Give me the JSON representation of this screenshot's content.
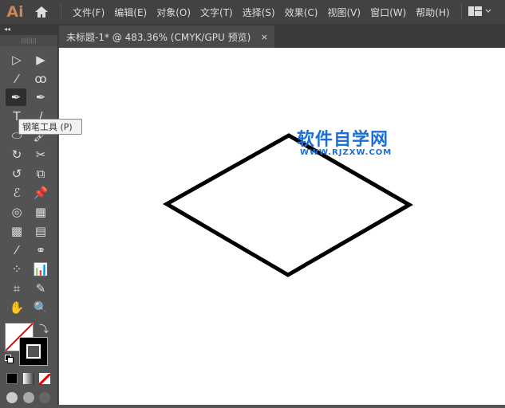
{
  "app": {
    "logo": "Ai"
  },
  "menu": [
    "文件(F)",
    "编辑(E)",
    "对象(O)",
    "文字(T)",
    "选择(S)",
    "效果(C)",
    "视图(V)",
    "窗口(W)",
    "帮助(H)"
  ],
  "tab": {
    "title": "未标题-1* @ 483.36% (CMYK/GPU 预览)",
    "close": "×"
  },
  "toolbar": {
    "collapse": "◂◂",
    "grip": "||||||||"
  },
  "tooltip": "钢笔工具 (P)",
  "watermark": {
    "title": "软件自学网",
    "url": "WWW.RJZXW.COM"
  },
  "colors": {
    "accent": "#1c6fd4",
    "chrome": "#535353"
  }
}
